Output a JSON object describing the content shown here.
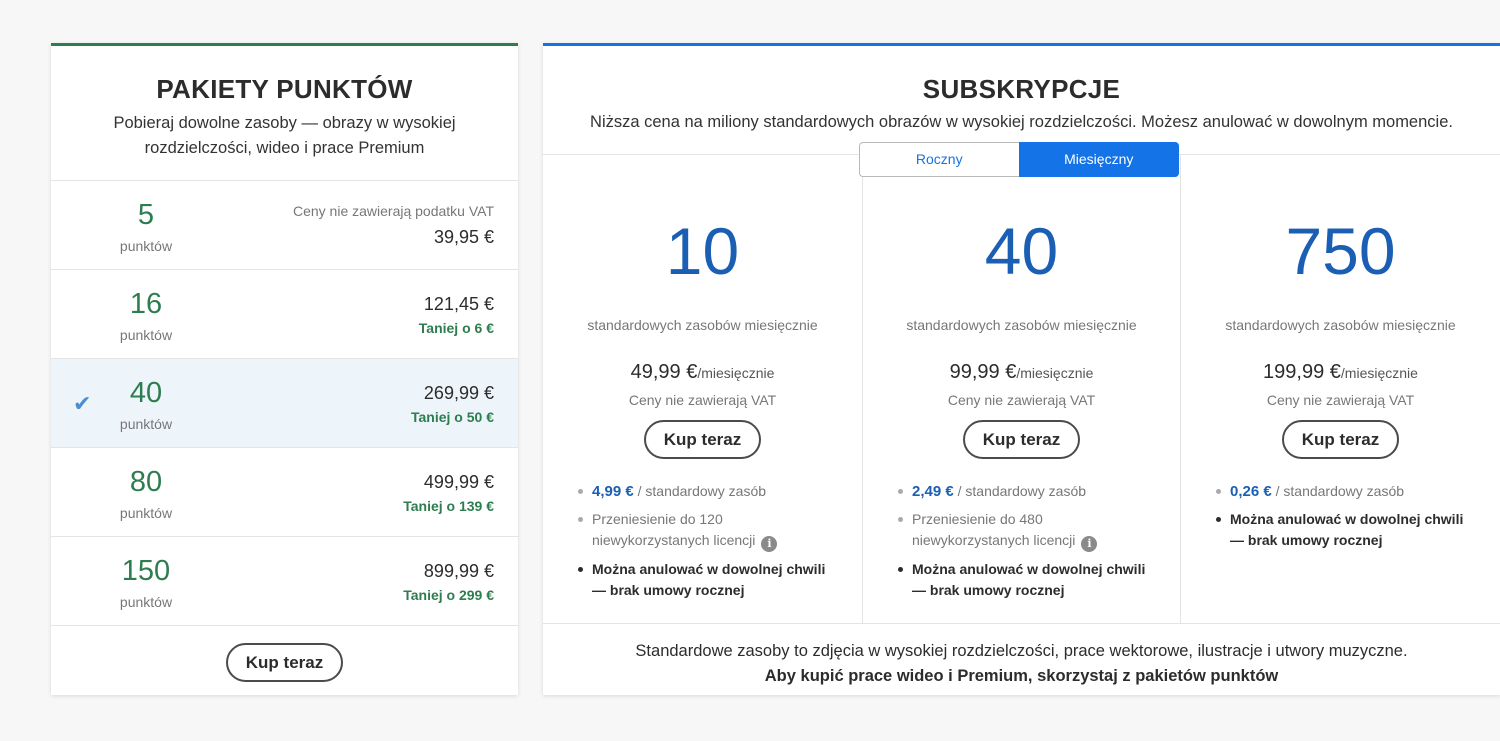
{
  "credit_packs": {
    "title": "PAKIETY PUNKTÓW",
    "subtitle": "Pobieraj dowolne zasoby — obrazy w wysokiej rozdzielczości, wideo i prace Premium",
    "vat_note": "Ceny nie zawierają podatku VAT",
    "unit_label": "punktów",
    "selected_index": 2,
    "packs": [
      {
        "count": "5",
        "price": "39,95 €",
        "saving": ""
      },
      {
        "count": "16",
        "price": "121,45 €",
        "saving": "Taniej o 6 €"
      },
      {
        "count": "40",
        "price": "269,99 €",
        "saving": "Taniej o 50 €"
      },
      {
        "count": "80",
        "price": "499,99 €",
        "saving": "Taniej o 139 €"
      },
      {
        "count": "150",
        "price": "899,99 €",
        "saving": "Taniej o 299 €"
      }
    ],
    "buy_label": "Kup teraz"
  },
  "subscriptions": {
    "title": "SUBSKRYPCJE",
    "subtitle": "Niższa cena na miliony standardowych obrazów w wysokiej rozdzielczości. Możesz anulować w dowolnym momencie.",
    "toggle": {
      "annual": "Roczny",
      "monthly": "Miesięczny",
      "active": "monthly"
    },
    "plans": [
      {
        "amount": "10",
        "desc": "standardowych zasobów miesięcznie",
        "price": "49,99 €",
        "per": "/miesięcznie",
        "vat": "Ceny nie zawierają VAT",
        "buy_label": "Kup teraz",
        "unit_price": "4,99 €",
        "unit_suffix": " / standardowy zasób",
        "rollover": "Przeniesienie do 120 niewykorzystanych licencji",
        "cancel": "Można anulować w dowolnej chwili — brak umowy rocznej"
      },
      {
        "amount": "40",
        "desc": "standardowych zasobów miesięcznie",
        "price": "99,99 €",
        "per": "/miesięcznie",
        "vat": "Ceny nie zawierają VAT",
        "buy_label": "Kup teraz",
        "unit_price": "2,49 €",
        "unit_suffix": " / standardowy zasób",
        "rollover": "Przeniesienie do 480 niewykorzystanych licencji",
        "cancel": "Można anulować w dowolnej chwili — brak umowy rocznej"
      },
      {
        "amount": "750",
        "desc": "standardowych zasobów miesięcznie",
        "price": "199,99 €",
        "per": "/miesięcznie",
        "vat": "Ceny nie zawierają VAT",
        "buy_label": "Kup teraz",
        "unit_price": "0,26 €",
        "unit_suffix": " / standardowy zasób",
        "cancel": "Można anulować w dowolnej chwili — brak umowy rocznej"
      }
    ],
    "footer_line1": "Standardowe zasoby to zdjęcia w wysokiej rozdzielczości, prace wektorowe, ilustracje i utwory muzyczne.",
    "footer_line2": "Aby kupić prace wideo i Premium, skorzystaj z pakietów punktów"
  },
  "colors": {
    "credit_accent": "#2d7d4f",
    "subscription_accent": "#1473e6",
    "selected_row_bg": "#eef5fa"
  },
  "icons": {
    "selected": "checkmark-icon",
    "info": "info-icon"
  }
}
